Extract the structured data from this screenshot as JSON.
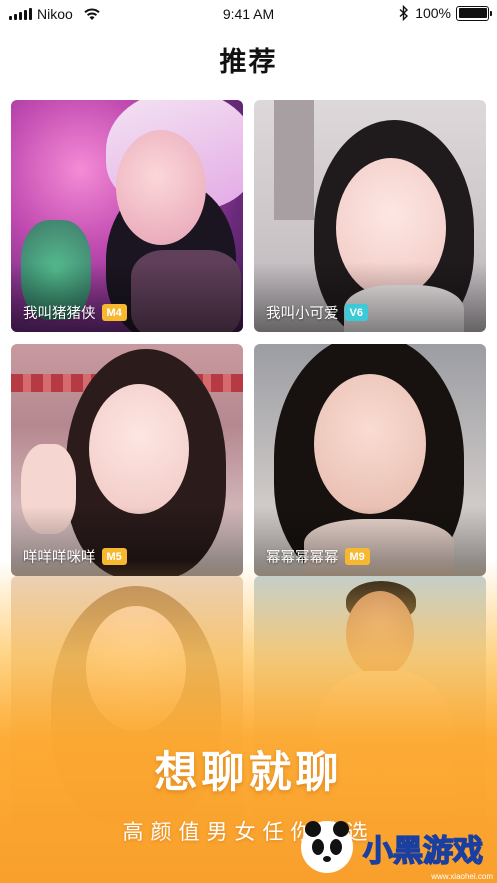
{
  "status_bar": {
    "carrier": "Nikoo",
    "time": "9:41 AM",
    "battery": "100%"
  },
  "header": {
    "title": "推荐"
  },
  "users": [
    {
      "name": "我叫猪猪侠",
      "badge": "M4",
      "badge_color": "#f5b82e"
    },
    {
      "name": "我叫小可爱",
      "badge": "V6",
      "badge_color": "#3cc9d8"
    },
    {
      "name": "咩咩咩咪咩",
      "badge": "M5",
      "badge_color": "#f5b82e"
    },
    {
      "name": "幂幂幂幂幂",
      "badge": "M9",
      "badge_color": "#f5b82e"
    }
  ],
  "promo": {
    "slogan": "想聊就聊",
    "subslogan": "高颜值男女任你挑选"
  },
  "watermark": {
    "logo_text": "小黑游戏",
    "url": "www.xiaohei.com"
  },
  "colors": {
    "accent": "#f99f2b",
    "badge_m": "#f5b82e",
    "badge_v": "#3cc9d8"
  }
}
